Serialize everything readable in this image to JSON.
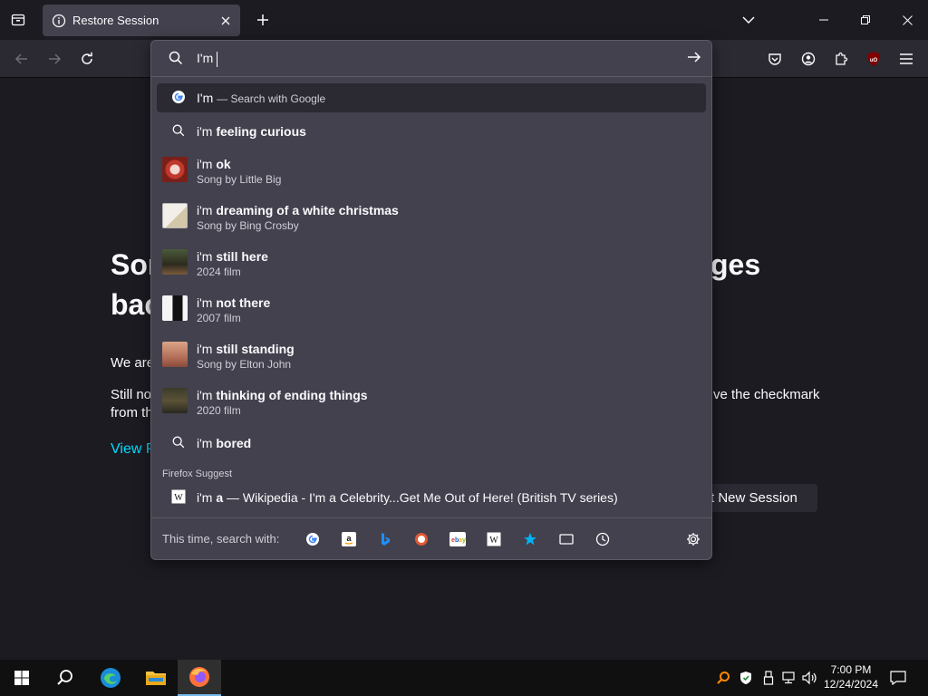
{
  "browser": {
    "tab_title": "Restore Session",
    "url_input_value": "I'm"
  },
  "page": {
    "heading_line1_start": "Sor",
    "heading_line1_end": "ges",
    "heading_line2_start": "bac",
    "para1_start": "We are",
    "para2_start": "Still no",
    "para2_end": "ve the checkmark",
    "para3_start": "from th",
    "link_start": "View P",
    "new_session_button": "t New Session"
  },
  "urlbar_results": {
    "search_row": {
      "typed": "I'm",
      "suffix": "— Search with Google"
    },
    "suggestions": [
      {
        "prefix": "i'm",
        "bold": "feeling curious",
        "subtitle": "",
        "icon": "search-icon"
      },
      {
        "prefix": "i'm",
        "bold": "ok",
        "subtitle": "Song by Little Big",
        "icon": "thumbnail"
      },
      {
        "prefix": "i'm",
        "bold": "dreaming of a white christmas",
        "subtitle": "Song by Bing Crosby",
        "icon": "thumbnail"
      },
      {
        "prefix": "i'm",
        "bold": "still here",
        "subtitle": "2024 film",
        "icon": "thumbnail"
      },
      {
        "prefix": "i'm",
        "bold": "not there",
        "subtitle": "2007 film",
        "icon": "thumbnail"
      },
      {
        "prefix": "i'm",
        "bold": "still standing",
        "subtitle": "Song by Elton John",
        "icon": "thumbnail"
      },
      {
        "prefix": "i'm",
        "bold": "thinking of ending things",
        "subtitle": "2020 film",
        "icon": "thumbnail"
      },
      {
        "prefix": "i'm",
        "bold": "bored",
        "subtitle": "",
        "icon": "search-icon"
      }
    ],
    "firefox_suggest_label": "Firefox Suggest",
    "wiki_row": {
      "prefix": "i'm",
      "bold": "a",
      "rest": "— Wikipedia - I'm a Celebrity...Get Me Out of Here! (British TV series)"
    },
    "this_time_label": "This time, search with:",
    "engines": [
      "google-icon",
      "amazon-icon",
      "bing-icon",
      "duckduckgo-icon",
      "ebay-icon",
      "wikipedia-icon",
      "bookmarks-star-icon",
      "tabs-icon",
      "history-icon"
    ]
  },
  "taskbar": {
    "time": "7:00 PM",
    "date": "12/24/2024"
  },
  "colors": {
    "accent": "#00ddff",
    "panel": "#42414d",
    "background": "#1c1b22",
    "toolbar": "#2b2a33"
  }
}
